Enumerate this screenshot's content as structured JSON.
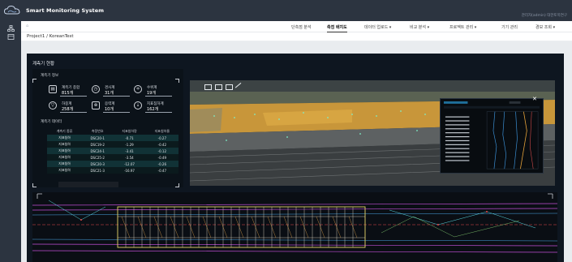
{
  "header": {
    "app_title": "Smart Monitoring System",
    "user_info": "관리자(admin) 대한토목연구"
  },
  "nav": {
    "home_icon": "home-icon",
    "items": [
      {
        "label": "단측점 분석",
        "active": false
      },
      {
        "label": "측점 배치도",
        "active": true
      },
      {
        "label": "데이터 업로드 ▾",
        "active": false
      },
      {
        "label": "비교 분석 ▾",
        "active": false
      },
      {
        "label": "프로젝트 관리 ▾",
        "active": false
      },
      {
        "label": "기기 관리",
        "active": false
      },
      {
        "label": "경보 조회 ▾",
        "active": false
      }
    ]
  },
  "breadcrumb": "Project1 /  KoreanTest",
  "panel": {
    "title": "계측기 현황",
    "info_title": "계측기 정보",
    "stats": [
      {
        "icon": "clipboard-icon",
        "label": "계측기 종합",
        "value": "815개"
      },
      {
        "icon": "clock-icon",
        "label": "경사계",
        "value": "31개"
      },
      {
        "icon": "level-icon",
        "label": "수위계",
        "value": "19개"
      },
      {
        "icon": "funnel-icon",
        "label": "하중계",
        "value": "258개"
      },
      {
        "icon": "strain-icon",
        "label": "응력계",
        "value": "10개"
      },
      {
        "icon": "settlement-icon",
        "label": "지표침하계",
        "value": "162개"
      }
    ],
    "table_title": "계측기 데이터",
    "table": {
      "columns": [
        "계측기 종류",
        "측정번호",
        "지표침하량",
        "지표침하율"
      ],
      "rows": [
        [
          "지표침하",
          "DSC20-1",
          "-0.71",
          "-0.27"
        ],
        [
          "지표침하",
          "DSC19-2",
          "-1.29",
          "-0.42"
        ],
        [
          "지표침하",
          "DSC24-1",
          "-3.41",
          "-0.12"
        ],
        [
          "지표침하",
          "DSC25-2",
          "-3.54",
          "-0.49"
        ],
        [
          "지표침하",
          "DSC20-3",
          "-12.07",
          "-0.26"
        ],
        [
          "지표침하",
          "DSC21-3",
          "-16.97",
          "-0.47"
        ]
      ]
    }
  },
  "map": {
    "toolbar": [
      "grid-icon",
      "columns-icon",
      "layer-icon",
      "measure-icon"
    ],
    "popup_close": "✕"
  },
  "colors": {
    "header_bg": "#2c3440",
    "panel_bg": "#0e1620",
    "table_row_alt": "#113236",
    "accent": "#3fd6c0"
  }
}
